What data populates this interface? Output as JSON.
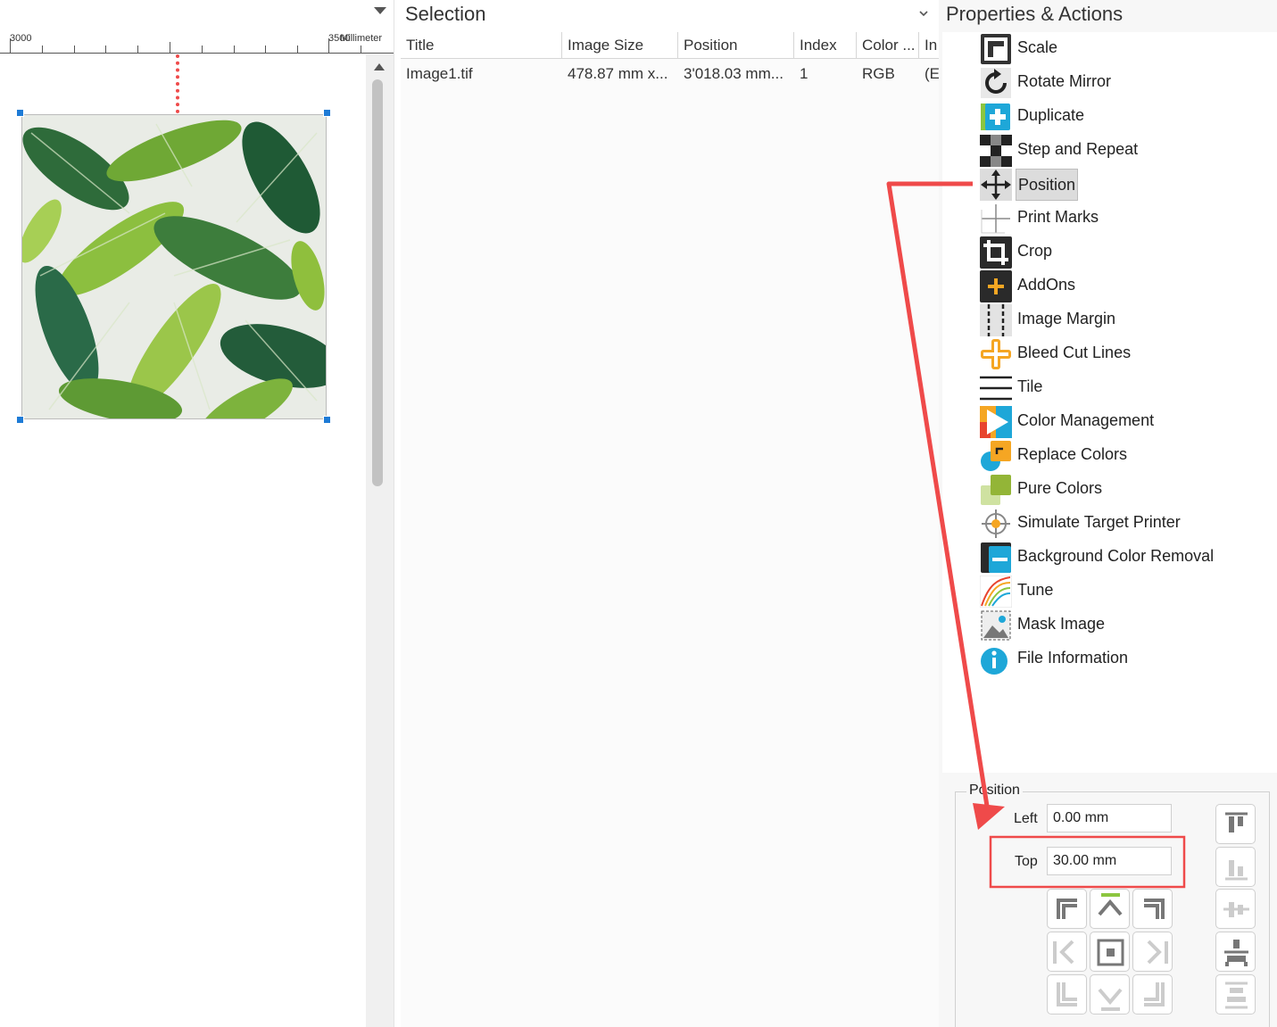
{
  "left_pane": {
    "ruler": {
      "start_label": "3000",
      "end_label": "3500",
      "unit": "Millimeter"
    }
  },
  "selection": {
    "title": "Selection",
    "columns": [
      "Title",
      "Image Size",
      "Position",
      "Index",
      "Color ...",
      "In"
    ],
    "rows": [
      [
        "Image1.tif",
        "478.87 mm x...",
        "3'018.03 mm...",
        "1",
        "RGB",
        "(E"
      ]
    ]
  },
  "properties": {
    "title": "Properties & Actions",
    "actions": [
      {
        "label": "Scale",
        "icon": "scale-icon"
      },
      {
        "label": "Rotate Mirror",
        "icon": "rotate-icon"
      },
      {
        "label": "Duplicate",
        "icon": "duplicate-icon"
      },
      {
        "label": "Step and Repeat",
        "icon": "checker-icon"
      },
      {
        "label": "Position",
        "icon": "move-arrows-icon",
        "selected": true
      },
      {
        "label": "Print Marks",
        "icon": "crosshair-icon"
      },
      {
        "label": "Crop",
        "icon": "crop-icon"
      },
      {
        "label": "AddOns",
        "icon": "addons-plus-icon"
      },
      {
        "label": "Image Margin",
        "icon": "margin-icon"
      },
      {
        "label": "Bleed Cut Lines",
        "icon": "bleed-cross-icon"
      },
      {
        "label": "Tile",
        "icon": "tile-icon"
      },
      {
        "label": "Color Management",
        "icon": "color-play-icon"
      },
      {
        "label": "Replace Colors",
        "icon": "replace-colors-icon"
      },
      {
        "label": "Pure Colors",
        "icon": "pure-colors-icon"
      },
      {
        "label": "Simulate Target Printer",
        "icon": "target-icon"
      },
      {
        "label": "Background Color Removal",
        "icon": "bg-removal-icon"
      },
      {
        "label": "Tune",
        "icon": "tune-curves-icon"
      },
      {
        "label": "Mask Image",
        "icon": "mask-image-icon"
      },
      {
        "label": "File Information",
        "icon": "info-icon"
      }
    ],
    "position": {
      "group_title": "Position",
      "left_label": "Left",
      "left_value": "0.00 mm",
      "top_label": "Top",
      "top_value": "30.00 mm"
    }
  },
  "colors": {
    "accent": "#1e7bd6",
    "annotation": "#ef4a4a",
    "selected_bg": "#dcdcdc"
  }
}
